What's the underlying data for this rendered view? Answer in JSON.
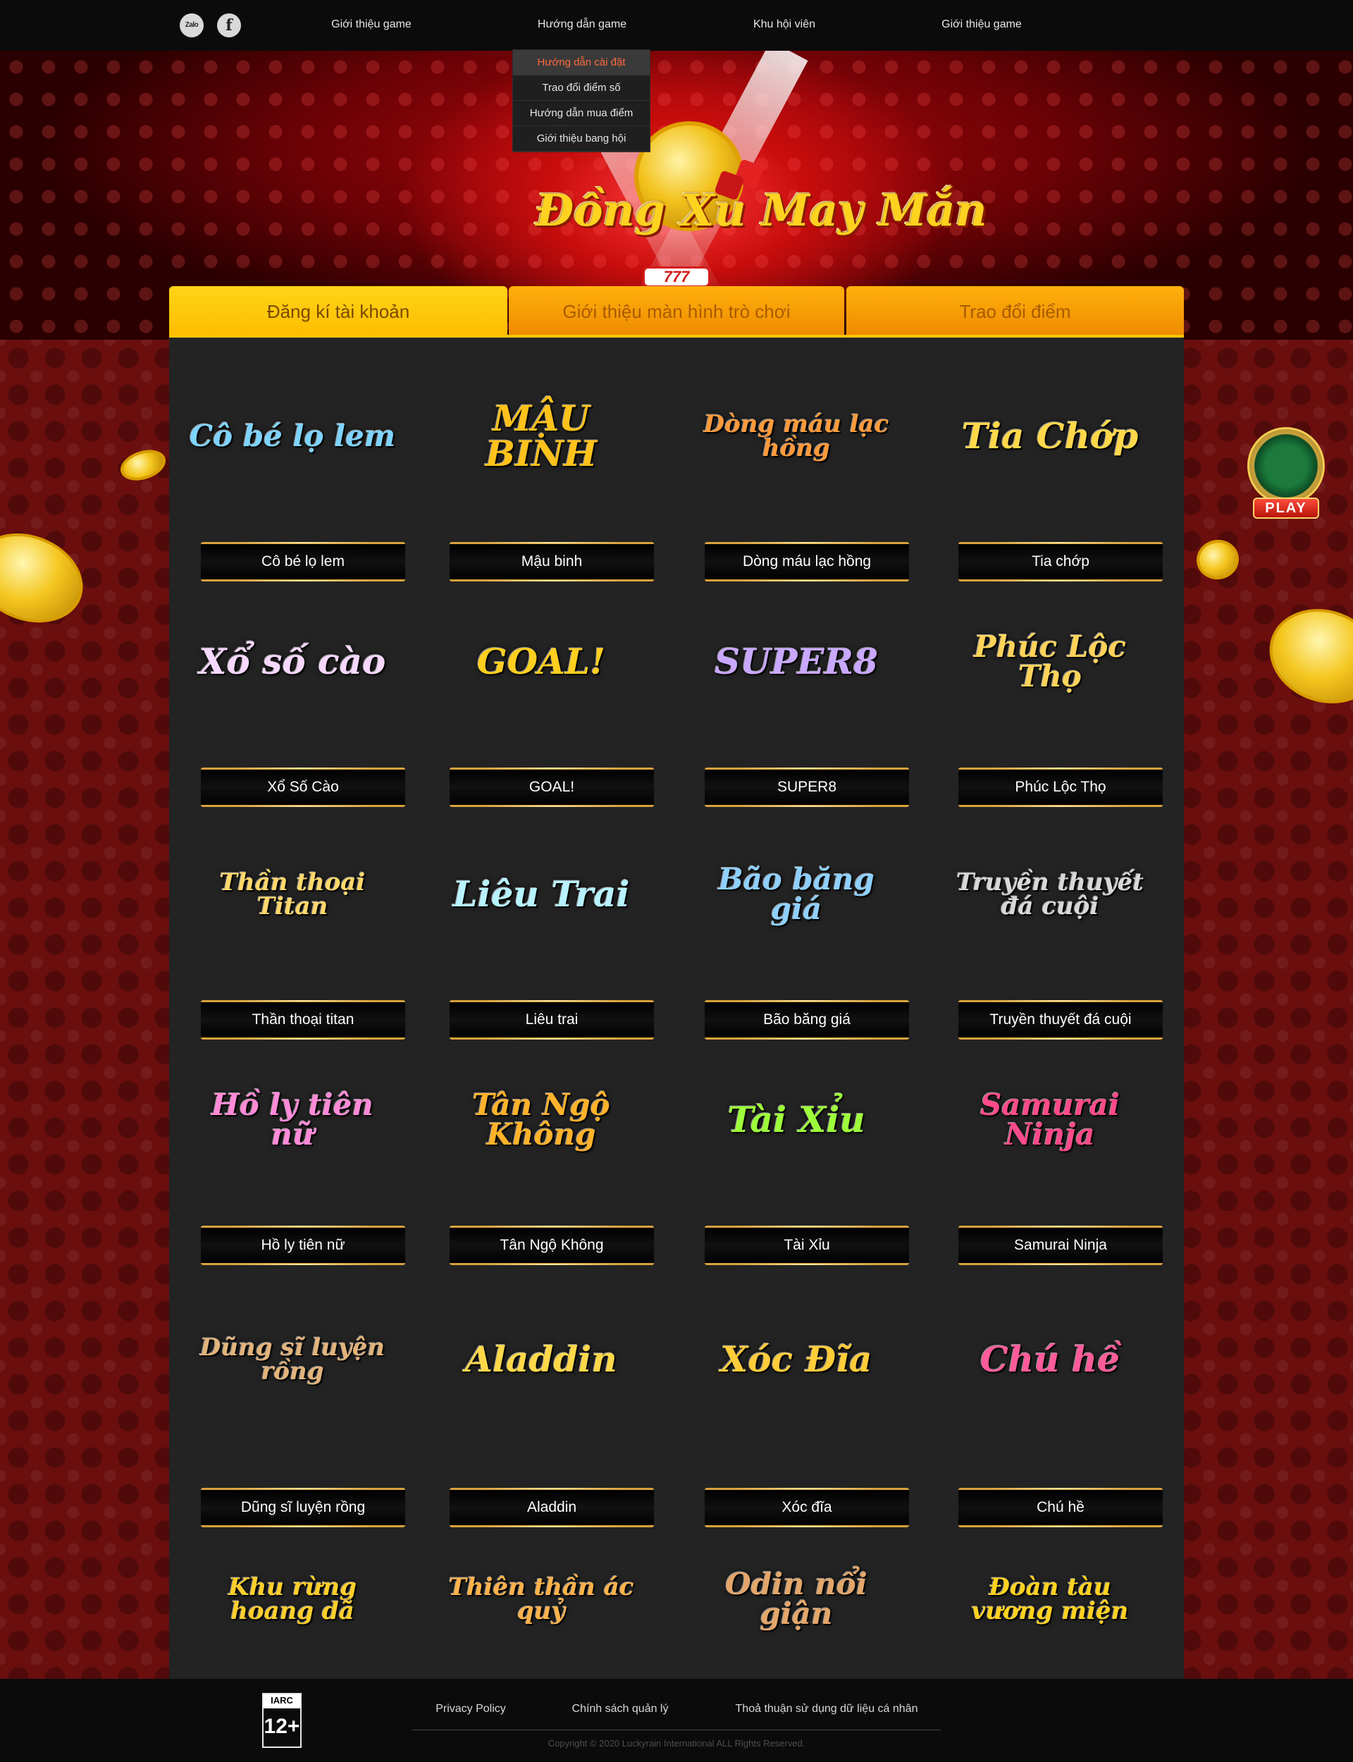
{
  "nav": {
    "social": {
      "zalo": "Zalo",
      "facebook": "f"
    },
    "items": [
      {
        "label": "Giới thiệu game"
      },
      {
        "label": "Hướng dẫn game"
      },
      {
        "label": "Khu hội viên"
      },
      {
        "label": "Giới thiệu game"
      }
    ],
    "dropdown": [
      {
        "label": "Hướng dẫn cài đặt",
        "active": true
      },
      {
        "label": "Trao đổi điểm số"
      },
      {
        "label": "Hướng dẫn mua điểm"
      },
      {
        "label": "Giới thiệu bang hội"
      }
    ]
  },
  "hero": {
    "logo_title": "Đồng Xu May Mắn",
    "logo_badge": "777"
  },
  "tabs": [
    {
      "label": "Đăng kí tài khoản",
      "active": true
    },
    {
      "label": "Giới thiệu màn hình trò chơi"
    },
    {
      "label": "Trao đổi điểm"
    }
  ],
  "games": [
    {
      "label": "Cô bé lọ lem",
      "logo": "Cô bé lọ lem",
      "color": "#7fd3ff"
    },
    {
      "label": "Mậu binh",
      "logo": "MẬU BINH",
      "color": "#ffc21a"
    },
    {
      "label": "Dòng máu lạc hồng",
      "logo": "Dòng máu lạc hồng",
      "color": "#ff9a3a"
    },
    {
      "label": "Tia chớp",
      "logo": "Tia Chớp",
      "color": "#ffd84a"
    },
    {
      "label": "Xổ Số Cào",
      "logo": "Xổ số cào",
      "color": "#f6d8ff"
    },
    {
      "label": "GOAL!",
      "logo": "GOAL!",
      "color": "#ffcf1f"
    },
    {
      "label": "SUPER8",
      "logo": "SUPER8",
      "color": "#c9a8ff"
    },
    {
      "label": "Phúc Lộc Thọ",
      "logo": "Phúc Lộc Thọ",
      "color": "#ffd35a"
    },
    {
      "label": "Thần thoại titan",
      "logo": "Thần thoại Titan",
      "color": "#ffd86a"
    },
    {
      "label": "Liêu trai",
      "logo": "Liêu Trai",
      "color": "#b8f2ff"
    },
    {
      "label": "Bão băng giá",
      "logo": "Bão băng giá",
      "color": "#8fd0ff"
    },
    {
      "label": "Truyền thuyết đá cuội",
      "logo": "Truyền thuyết đá cuội",
      "color": "#d8d8d8"
    },
    {
      "label": "Hồ ly tiên nữ",
      "logo": "Hồ ly tiên nữ",
      "color": "#ff8ad8"
    },
    {
      "label": "Tân Ngộ Không",
      "logo": "Tân Ngộ Không",
      "color": "#ffb22a"
    },
    {
      "label": "Tài Xỉu",
      "logo": "Tài Xỉu",
      "color": "#9dff3a"
    },
    {
      "label": "Samurai Ninja",
      "logo": "Samurai Ninja",
      "color": "#ff4a8a"
    },
    {
      "label": "Dũng sĩ luyện rồng",
      "logo": "Dũng sĩ luyện rồng",
      "color": "#e2b37a"
    },
    {
      "label": "Aladdin",
      "logo": "Aladdin",
      "color": "#ffd84a"
    },
    {
      "label": "Xóc đĩa",
      "logo": "Xóc Đĩa",
      "color": "#ffcc3a"
    },
    {
      "label": "Chú hề",
      "logo": "Chú hề",
      "color": "#ff5b9a"
    },
    {
      "label": "",
      "logo": "Khu rừng hoang dã",
      "color": "#ffcf2a"
    },
    {
      "label": "",
      "logo": "Thiên thần ác quỷ",
      "color": "#ffb24a"
    },
    {
      "label": "",
      "logo": "Odin nổi giận",
      "color": "#e3a66a"
    },
    {
      "label": "",
      "logo": "Đoàn tàu vương miện",
      "color": "#ffd21f"
    }
  ],
  "side_badge": {
    "label": "PLAY"
  },
  "footer": {
    "iarc_title": "IARC",
    "iarc_rating": "12+",
    "links": [
      {
        "label": "Privacy Policy"
      },
      {
        "label": "Chính sách quản lý"
      },
      {
        "label": "Thoả thuận sử dụng dữ liệu cá nhân"
      }
    ],
    "copyright": "Copyright © 2020 Luckyrain International  ALL Rights Reserved."
  }
}
